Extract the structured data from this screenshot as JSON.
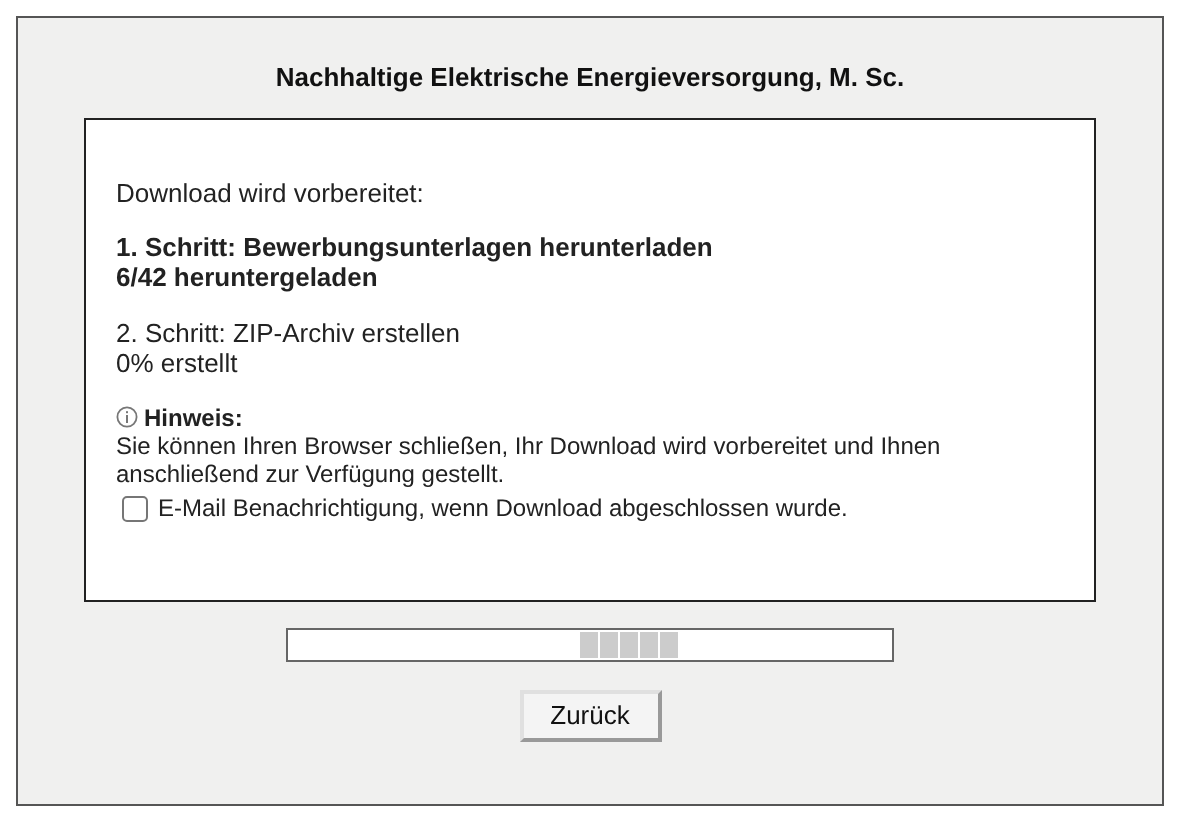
{
  "title": "Nachhaltige Elektrische Energieversorgung, M. Sc.",
  "status": "Download wird vorbereitet:",
  "steps": [
    {
      "heading": "1. Schritt: Bewerbungsunterlagen herunterladen",
      "progress": "6/42 heruntergeladen",
      "active": true
    },
    {
      "heading": "2. Schritt: ZIP-Archiv erstellen",
      "progress": "0% erstellt",
      "active": false
    }
  ],
  "notice": {
    "label": "Hinweis:",
    "text": "Sie können Ihren Browser schließen, Ihr Download wird vorbereitet und Ihnen anschließend zur Verfügung gestellt."
  },
  "email_option": {
    "label": "E-Mail Benachrichtigung, wenn Download abgeschlossen wurde.",
    "checked": false
  },
  "busy_indicator": {
    "kind": "indeterminate"
  },
  "back_button": "Zurück"
}
